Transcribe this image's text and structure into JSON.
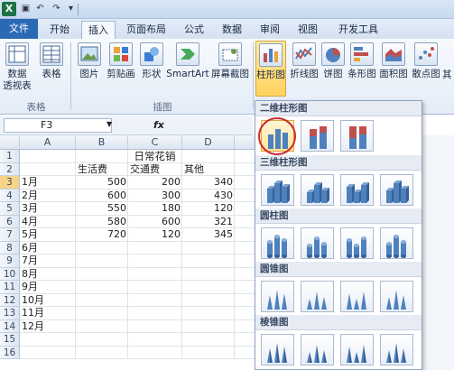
{
  "quick_access": {
    "icons": [
      "save-icon",
      "undo-icon",
      "redo-icon",
      "customize-icon"
    ]
  },
  "tabs": [
    {
      "label": "文件"
    },
    {
      "label": "开始"
    },
    {
      "label": "插入"
    },
    {
      "label": "页面布局"
    },
    {
      "label": "公式"
    },
    {
      "label": "数据"
    },
    {
      "label": "审阅"
    },
    {
      "label": "视图"
    },
    {
      "label": "开发工具"
    }
  ],
  "ribbon": {
    "groups": [
      {
        "label": "表格"
      },
      {
        "label": "插图"
      }
    ],
    "buttons": [
      {
        "label": "数据\n透视表"
      },
      {
        "label": "表格"
      },
      {
        "label": "图片"
      },
      {
        "label": "剪贴画"
      },
      {
        "label": "形状"
      },
      {
        "label": "SmartArt"
      },
      {
        "label": "屏幕截图"
      },
      {
        "label": "柱形图"
      },
      {
        "label": "折线图"
      },
      {
        "label": "饼图"
      },
      {
        "label": "条形图"
      },
      {
        "label": "面积图"
      },
      {
        "label": "散点图"
      },
      {
        "label": "其"
      }
    ]
  },
  "formula_bar": {
    "name_box": "F3",
    "fx": "fx"
  },
  "sheet": {
    "columns": [
      "A",
      "B",
      "C",
      "D"
    ],
    "rows": [
      "1",
      "2",
      "3",
      "4",
      "5",
      "6",
      "7",
      "8",
      "9",
      "10",
      "11",
      "12",
      "13",
      "14",
      "15",
      "16"
    ],
    "title": "日常花销",
    "headers": [
      "生活费",
      "交通费",
      "其他"
    ],
    "data": [
      {
        "month": "1月",
        "b": "500",
        "c": "200",
        "d": "340"
      },
      {
        "month": "2月",
        "b": "600",
        "c": "300",
        "d": "430"
      },
      {
        "month": "3月",
        "b": "550",
        "c": "180",
        "d": "120"
      },
      {
        "month": "4月",
        "b": "580",
        "c": "600",
        "d": "321"
      },
      {
        "month": "5月",
        "b": "720",
        "c": "120",
        "d": "345"
      },
      {
        "month": "6月",
        "b": "",
        "c": "",
        "d": ""
      },
      {
        "month": "7月",
        "b": "",
        "c": "",
        "d": ""
      },
      {
        "month": "8月",
        "b": "",
        "c": "",
        "d": ""
      },
      {
        "month": "9月",
        "b": "",
        "c": "",
        "d": ""
      },
      {
        "month": "10月",
        "b": "",
        "c": "",
        "d": ""
      },
      {
        "month": "11月",
        "b": "",
        "c": "",
        "d": ""
      },
      {
        "month": "12月",
        "b": "",
        "c": "",
        "d": ""
      }
    ]
  },
  "chart_menu": {
    "sections": [
      {
        "label": "二维柱形图",
        "count": 3
      },
      {
        "label": "三维柱形图",
        "count": 4
      },
      {
        "label": "圆柱图",
        "count": 4
      },
      {
        "label": "圆锥图",
        "count": 4
      },
      {
        "label": "棱锥图",
        "count": 4
      }
    ]
  },
  "colors": {
    "accent": "#2a6ab5",
    "highlight": "#cc2a2a",
    "bar_blue": "#4f81bd"
  }
}
